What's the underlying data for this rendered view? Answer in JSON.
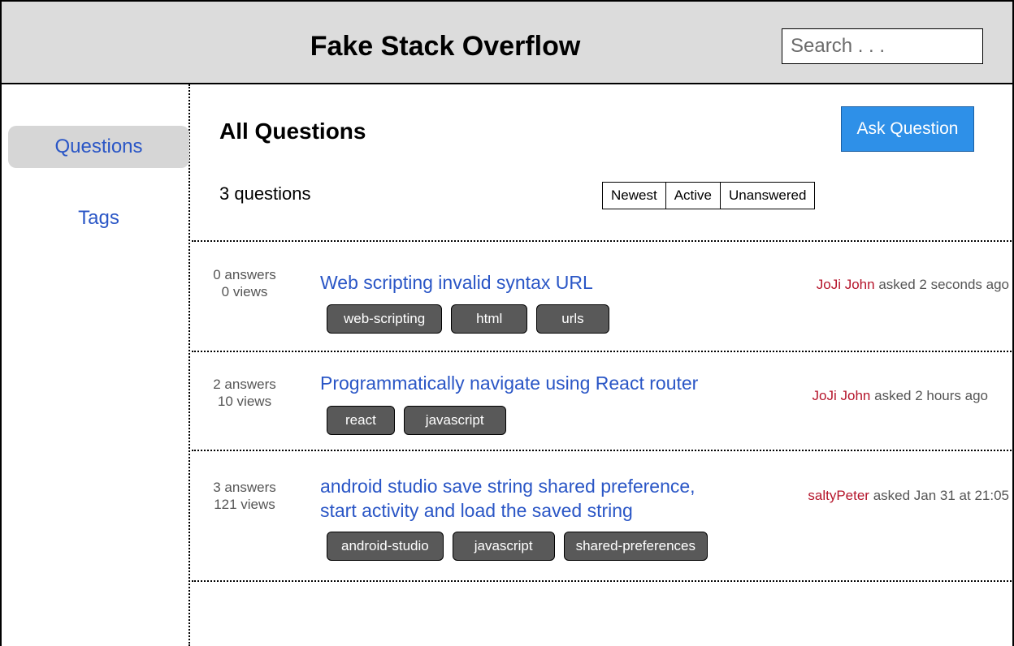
{
  "header": {
    "title": "Fake Stack Overflow",
    "search_placeholder": "Search . . ."
  },
  "sidebar": {
    "items": [
      {
        "label": "Questions",
        "active": true
      },
      {
        "label": "Tags",
        "active": false
      }
    ]
  },
  "main": {
    "title": "All Questions",
    "ask_button": "Ask Question",
    "count_text": "3 questions",
    "sort_options": [
      "Newest",
      "Active",
      "Unanswered"
    ]
  },
  "questions": [
    {
      "answers": "0 answers",
      "views": "0 views",
      "title_lines": [
        "Web scripting invalid syntax URL"
      ],
      "tags": [
        "web-scripting",
        "html",
        "urls"
      ],
      "author": "JoJi John",
      "asked": "asked 2 seconds ago"
    },
    {
      "answers": "2 answers",
      "views": "10 views",
      "title_lines": [
        "Programmatically navigate using React router"
      ],
      "tags": [
        "react",
        "javascript"
      ],
      "author": "JoJi John",
      "asked": "asked 2 hours ago"
    },
    {
      "answers": "3 answers",
      "views": "121 views",
      "title_lines": [
        "android studio save string shared preference,",
        "start activity and load the saved string"
      ],
      "tags": [
        "android-studio",
        "javascript",
        "shared-preferences"
      ],
      "author": "saltyPeter",
      "asked": "asked Jan 31 at 21:05"
    }
  ],
  "colors": {
    "link": "#2a56c6",
    "author": "#b5152b",
    "ask_button": "#2e90e8",
    "tag_bg": "#595959",
    "header_bg": "#dcdcdc"
  }
}
